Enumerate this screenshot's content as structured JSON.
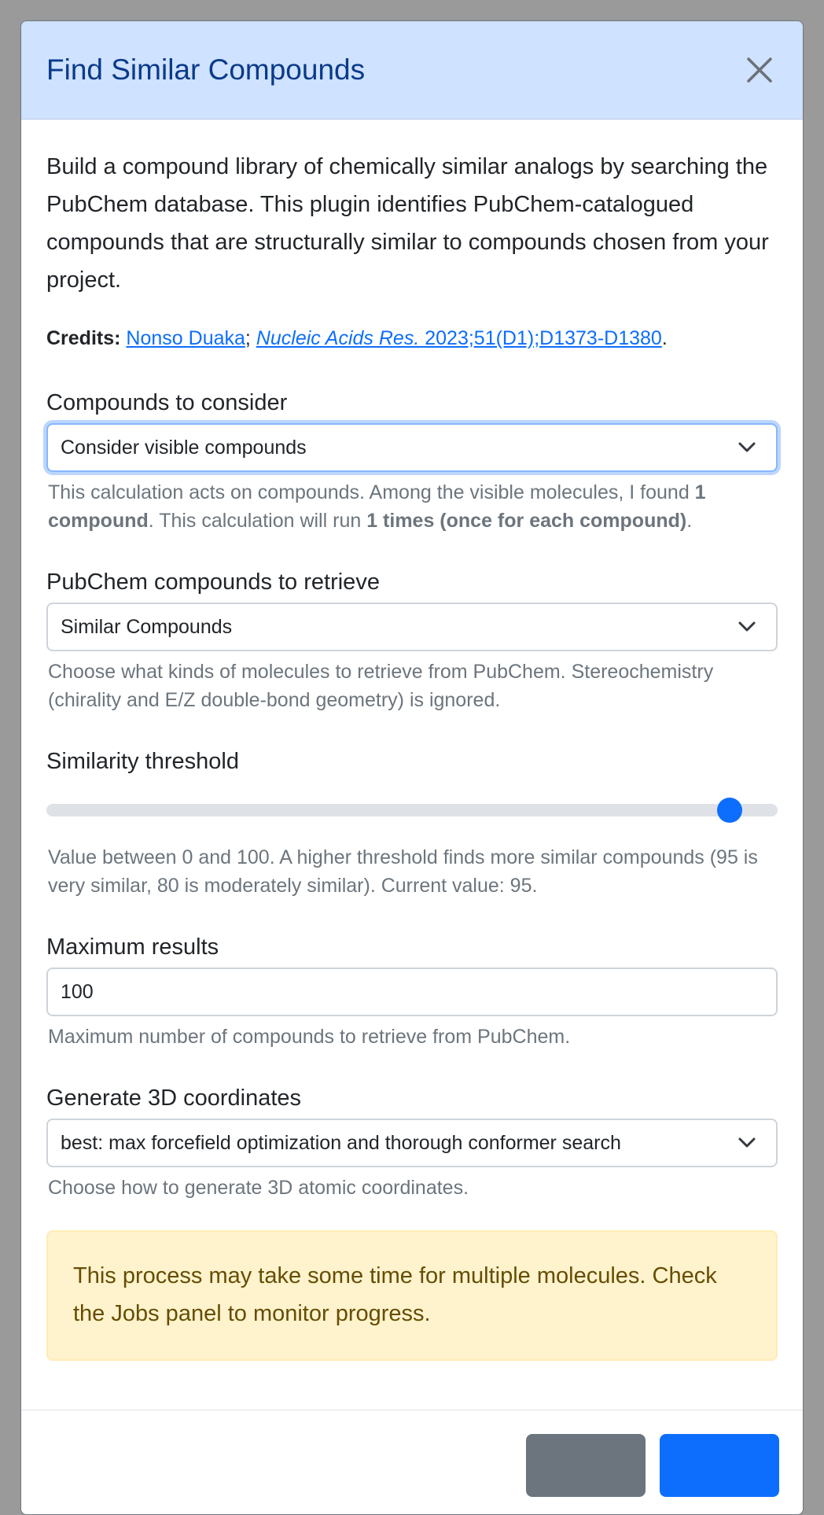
{
  "header": {
    "title": "Find Similar Compounds"
  },
  "intro": "Build a compound library of chemically similar analogs by searching the PubChem database. This plugin identifies PubChem-catalogued compounds that are structurally similar to compounds chosen from your project.",
  "credits": {
    "label": "Credits:",
    "author_link": "Nonso Duaka",
    "separator": ";",
    "journal_italic": "Nucleic Acids Res.",
    "journal_rest": " 2023;51(D1);D1373-D1380",
    "end": "."
  },
  "compounds_to_consider": {
    "label": "Compounds to consider",
    "selected": "Consider visible compounds",
    "help_1": "This calculation acts on compounds. Among the visible molecules, I found ",
    "help_bold_1": "1 compound",
    "help_2": ". This calculation will run ",
    "help_bold_2": "1 times (once for each compound)",
    "help_3": "."
  },
  "retrieve": {
    "label": "PubChem compounds to retrieve",
    "selected": "Similar Compounds",
    "help": "Choose what kinds of molecules to retrieve from PubChem. Stereochemistry (chirality and E/Z double-bond geometry) is ignored."
  },
  "similarity": {
    "label": "Similarity threshold",
    "value": 95,
    "min": 0,
    "max": 100,
    "help": "Value between 0 and 100. A higher threshold finds more similar compounds (95 is very similar, 80 is moderately similar). Current value: 95."
  },
  "max_results": {
    "label": "Maximum results",
    "value": "100",
    "help": "Maximum number of compounds to retrieve from PubChem."
  },
  "coords": {
    "label": "Generate 3D coordinates",
    "selected": "best: max forcefield optimization and thorough conformer search",
    "help": "Choose how to generate 3D atomic coordinates."
  },
  "alert": "This process may take some time for multiple molecules. Check the Jobs panel to monitor progress.",
  "footer": {
    "cancel_label": "",
    "ok_label": ""
  },
  "colors": {
    "header_bg": "#cfe2ff",
    "primary": "#0d6efd",
    "alert_bg": "#fff3cd",
    "muted": "#6c757d"
  }
}
